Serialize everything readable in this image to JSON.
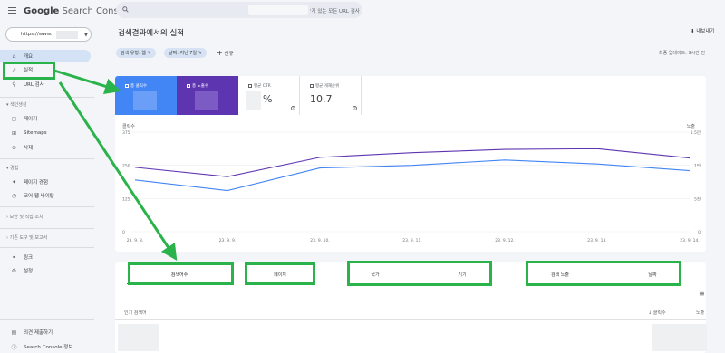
{
  "app": {
    "logo_google": "Google",
    "logo_rest": "Search Console"
  },
  "search": {
    "placeholder": "'게 있는 모든 URL 검사"
  },
  "property": {
    "value": "https://www."
  },
  "sidebar": {
    "items": [
      {
        "label": "개요",
        "icon": "home-icon",
        "glyph": "⌂"
      },
      {
        "label": "실적",
        "icon": "trending-icon",
        "glyph": "↗"
      },
      {
        "label": "URL 검사",
        "icon": "search-icon",
        "glyph": "⚲"
      }
    ],
    "indexing_section": "색인생성",
    "indexing": [
      {
        "label": "페이지",
        "glyph": "▢"
      },
      {
        "label": "Sitemaps",
        "glyph": "⊞"
      },
      {
        "label": "삭제",
        "glyph": "⊘"
      }
    ],
    "experience_section": "경험",
    "experience": [
      {
        "label": "페이지 경험",
        "glyph": "✦"
      },
      {
        "label": "코어 웹 바이탈",
        "glyph": "◔"
      }
    ],
    "security_section": "보안 및 직접 조치",
    "legacy_section": "기존 도구 및 보고서",
    "more": [
      {
        "label": "링크",
        "glyph": "⚭"
      },
      {
        "label": "설정",
        "glyph": "⚙"
      }
    ],
    "bottom": [
      {
        "label": "의견 제출하기",
        "glyph": "▤"
      },
      {
        "label": "Search Console 정보",
        "glyph": "ⓘ"
      }
    ]
  },
  "header": {
    "title": "검색결과에서의 실적",
    "export": "내보내기",
    "updated": "최종 업데이트: 9시간 전"
  },
  "filters": {
    "chip1": "검색 유형: 웹",
    "chip2": "날짜: 지난 7일",
    "new": "신규"
  },
  "metrics": {
    "clicks_label": "총 클릭수",
    "impr_label": "총 노출수",
    "ctr_label": "평균 CTR",
    "ctr_value": "%",
    "pos_label": "평균 게재순위",
    "pos_value": "10.7"
  },
  "colors": {
    "clicks": "#4285f4",
    "impressions": "#5e35b1",
    "green": "#2ab34a"
  },
  "chart_data": {
    "type": "line",
    "left_axis_label": "클릭수",
    "right_axis_label": "노출",
    "left_ticks": [
      "375",
      "250",
      "125",
      "0"
    ],
    "right_ticks": [
      "1.5만",
      "1만",
      "5천",
      "0"
    ],
    "ylim_left": [
      0,
      375
    ],
    "x": [
      "23. 9. 8.",
      "23. 9. 9.",
      "23. 9. 10.",
      "23. 9. 11.",
      "23. 9. 12.",
      "23. 9. 13.",
      "23. 9. 14."
    ],
    "series": [
      {
        "name": "클릭수",
        "axis": "left",
        "values": [
          195,
          155,
          240,
          250,
          270,
          255,
          230
        ]
      },
      {
        "name": "노출",
        "axis": "right",
        "values": [
          9700,
          8300,
          11200,
          11900,
          12400,
          12500,
          11100
        ]
      }
    ]
  },
  "tabs": [
    "검색어수",
    "페이지",
    "국가",
    "기기",
    "검색 노출",
    "날짜"
  ],
  "table": {
    "col_query": "인기 검색어",
    "col_clicks": "클릭수",
    "col_impr": "노출"
  }
}
